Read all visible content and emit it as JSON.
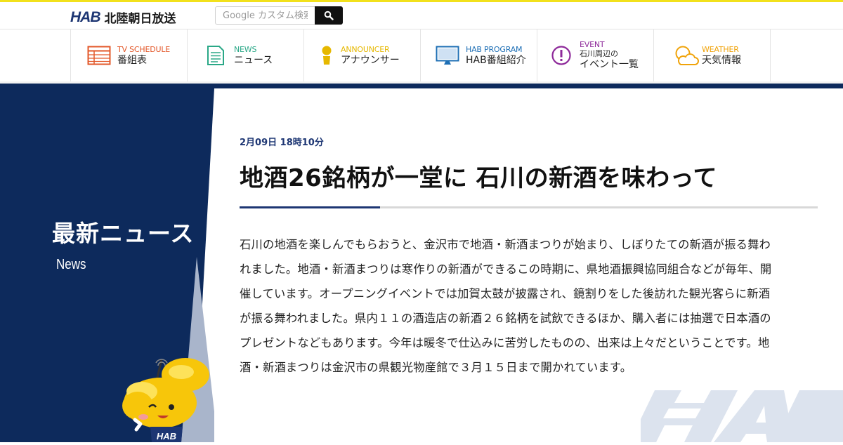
{
  "header": {
    "logo_mark": "HAB",
    "logo_text": "北陸朝日放送",
    "search_placeholder": "Google カスタム検索"
  },
  "nav": [
    {
      "en": "TV SCHEDULE",
      "ja": "番組表",
      "icon": "tv-schedule-icon",
      "color": "#e3582a"
    },
    {
      "en": "NEWS",
      "ja": "ニュース",
      "icon": "news-document-icon",
      "color": "#2aa887"
    },
    {
      "en": "ANNOUNCER",
      "ja": "アナウンサー",
      "icon": "announcer-person-icon",
      "color": "#e6b800"
    },
    {
      "en": "HAB PROGRAM",
      "ja": "HAB番組紹介",
      "icon": "monitor-icon",
      "color": "#1e6fb5"
    },
    {
      "en": "EVENT",
      "ja_line1": "石川周辺の",
      "ja_line2": "イベント一覧",
      "icon": "exclamation-circle-icon",
      "color": "#8e2a9a"
    },
    {
      "en": "WEATHER",
      "ja": "天気情報",
      "icon": "sun-cloud-icon",
      "color": "#f0a30a"
    }
  ],
  "section": {
    "title": "最新ニュース",
    "subtitle": "News"
  },
  "article": {
    "date": "2月09日 18時10分",
    "headline": "地酒26銘柄が一堂に 石川の新酒を味わって",
    "body": "石川の地酒を楽しんでもらおうと、金沢市で地酒・新酒まつりが始まり、しぼりたての新酒が振る舞われました。地酒・新酒まつりは寒作りの新酒ができるこの時期に、県地酒振興協同組合などが毎年、開催しています。オープニングイベントでは加賀太鼓が披露され、鏡割りをした後訪れた観光客らに新酒が振る舞われました。県内１１の酒造店の新酒２６銘柄を試飲できるほか、購入者には抽選で日本酒のプレゼントなどもあります。今年は暖冬で仕込みに苦労したものの、出来は上々だということです。地酒・新酒まつりは金沢市の県観光物産館で３月１５日まで開かれています。"
  },
  "colors": {
    "navy": "#0d2a5c",
    "accent_yellow": "#f2e11c"
  }
}
